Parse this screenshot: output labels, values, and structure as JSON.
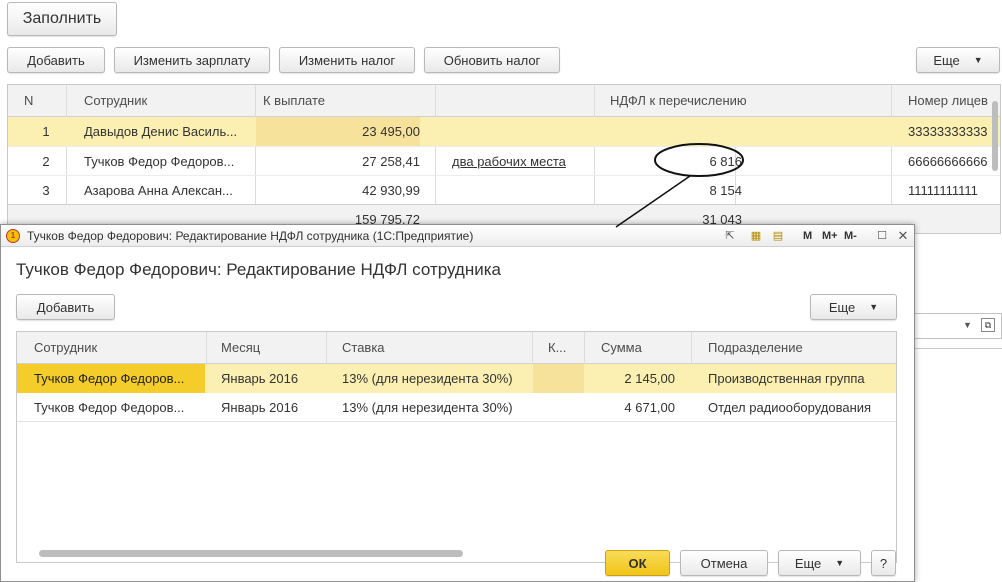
{
  "main": {
    "fill_button": "Заполнить",
    "toolbar": {
      "add": "Добавить",
      "change_salary": "Изменить зарплату",
      "change_tax": "Изменить налог",
      "update_tax": "Обновить налог",
      "more": "Еще"
    },
    "table": {
      "columns": [
        "N",
        "Сотрудник",
        "К выплате",
        "НДФЛ к перечислению",
        "Номер лицев"
      ],
      "rows": [
        {
          "n": "1",
          "employee": "Давыдов Денис Василь...",
          "payout": "23 495,00",
          "note": "",
          "ndfl": "",
          "account": "33333333333"
        },
        {
          "n": "2",
          "employee": "Тучков Федор Федоров...",
          "payout": "27 258,41",
          "note": "два рабочих места",
          "ndfl": "6 816",
          "account": "66666666666"
        },
        {
          "n": "3",
          "employee": "Азарова Анна Алексан...",
          "payout": "42 930,99",
          "note": "",
          "ndfl": "8 154",
          "account": "11111111111"
        }
      ],
      "totals": {
        "payout": "159 795,72",
        "ndfl": "31 043"
      }
    }
  },
  "dialog": {
    "window_title": "Тучков Федор Федорович: Редактирование НДФЛ сотрудника  (1С:Предприятие)",
    "heading": "Тучков Федор Федорович: Редактирование НДФЛ сотрудника",
    "titlebar_buttons": {
      "m": "M",
      "mplus": "M+",
      "mminus": "M-"
    },
    "add_button": "Добавить",
    "more_button": "Еще",
    "table": {
      "columns": [
        "Сотрудник",
        "Месяц",
        "Ставка",
        "К...",
        "Сумма",
        "Подразделение"
      ],
      "rows": [
        {
          "employee": "Тучков Федор Федоров...",
          "month": "Январь 2016",
          "rate": "13% (для нерезидента 30%)",
          "k": "",
          "sum": "2 145,00",
          "division": "Производственная группа"
        },
        {
          "employee": "Тучков Федор Федоров...",
          "month": "Январь 2016",
          "rate": "13% (для нерезидента 30%)",
          "k": "",
          "sum": "4 671,00",
          "division": "Отдел радиооборудования"
        }
      ]
    },
    "footer": {
      "ok": "ОК",
      "cancel": "Отмена",
      "more": "Еще",
      "help": "?"
    }
  },
  "colors": {
    "selected_row": "#fbf0b2",
    "ok_button": "#f5cd2a",
    "header_bg": "#f2f2f2"
  }
}
